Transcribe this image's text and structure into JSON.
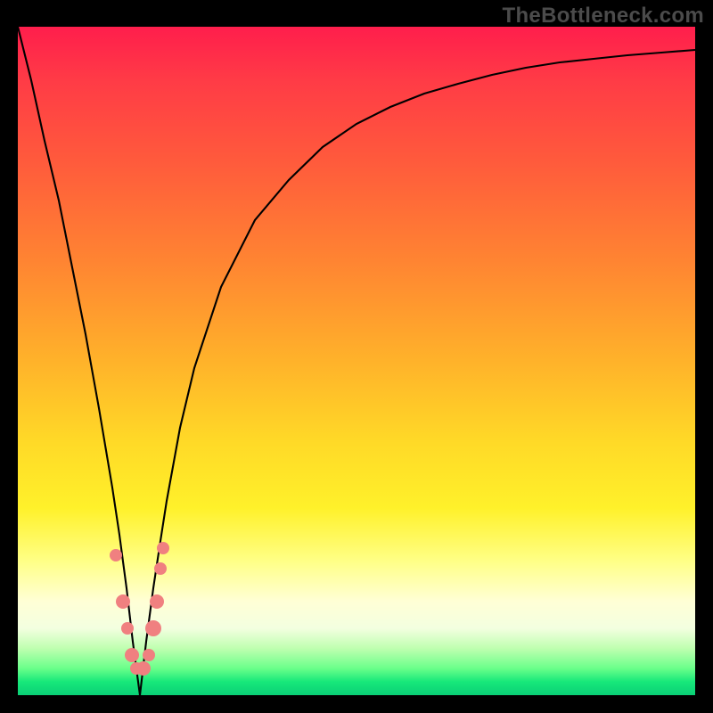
{
  "watermark": "TheBottleneck.com",
  "chart_data": {
    "type": "line",
    "title": "",
    "xlabel": "",
    "ylabel": "",
    "xlim": [
      0,
      100
    ],
    "ylim": [
      0,
      100
    ],
    "grid": false,
    "legend": false,
    "series": [
      {
        "name": "bottleneck-curve",
        "x": [
          0,
          2,
          4,
          6,
          8,
          10,
          12,
          14,
          15,
          16,
          17,
          18,
          19,
          20,
          21,
          22,
          24,
          26,
          30,
          35,
          40,
          45,
          50,
          55,
          60,
          65,
          70,
          75,
          80,
          85,
          90,
          95,
          100
        ],
        "y": [
          100,
          92,
          83,
          74,
          64,
          54,
          43,
          31,
          24,
          16,
          8,
          0,
          8,
          16,
          23,
          29,
          40,
          49,
          61,
          71,
          77,
          82,
          85.5,
          88,
          90,
          91.5,
          92.8,
          93.8,
          94.6,
          95.2,
          95.7,
          96.1,
          96.5
        ]
      },
      {
        "name": "marker-dots",
        "type": "scatter",
        "color": "#f08080",
        "x": [
          14.5,
          15.5,
          16.2,
          16.8,
          17.5,
          18.5,
          19.3,
          20.0,
          20.5,
          21.0,
          21.5
        ],
        "y": [
          21,
          14,
          10,
          6,
          4,
          4,
          6,
          10,
          14,
          19,
          22
        ]
      }
    ],
    "gradient_stops": [
      {
        "pos": 0.0,
        "color": "#ff1e4c"
      },
      {
        "pos": 0.2,
        "color": "#ff5a3c"
      },
      {
        "pos": 0.5,
        "color": "#ffb22a"
      },
      {
        "pos": 0.72,
        "color": "#fff12a"
      },
      {
        "pos": 0.9,
        "color": "#f3ffe0"
      },
      {
        "pos": 1.0,
        "color": "#0acf76"
      }
    ]
  }
}
